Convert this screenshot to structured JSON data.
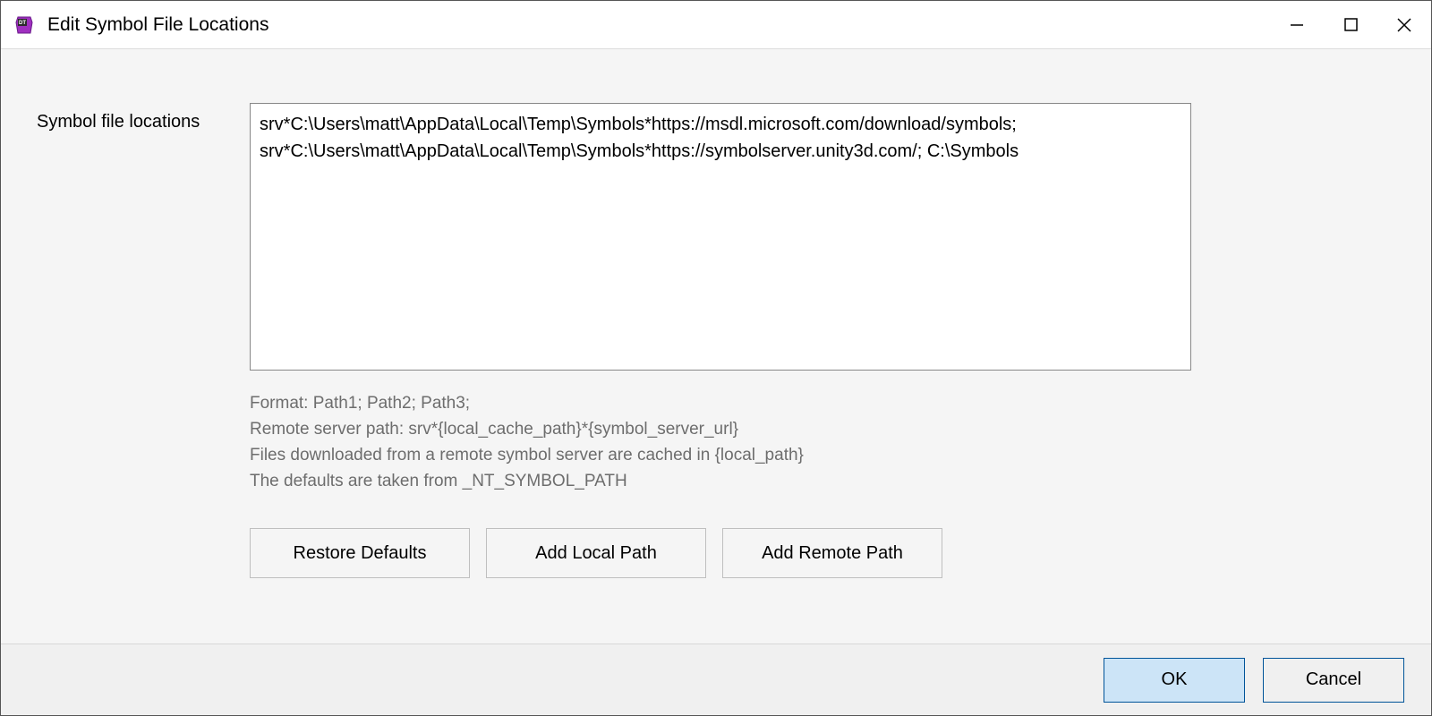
{
  "window": {
    "title": "Edit Symbol File Locations"
  },
  "form": {
    "label": "Symbol file locations",
    "value": "srv*C:\\Users\\matt\\AppData\\Local\\Temp\\Symbols*https://msdl.microsoft.com/download/symbols; srv*C:\\Users\\matt\\AppData\\Local\\Temp\\Symbols*https://symbolserver.unity3d.com/; C:\\Symbols"
  },
  "help": {
    "line1": "Format: Path1; Path2; Path3;",
    "line2": "Remote server path: srv*{local_cache_path}*{symbol_server_url}",
    "line3": "Files downloaded from a remote symbol server are cached in {local_path}",
    "line4": "The defaults are taken from _NT_SYMBOL_PATH"
  },
  "buttons": {
    "restore_defaults": "Restore Defaults",
    "add_local_path": "Add Local Path",
    "add_remote_path": "Add Remote Path",
    "ok": "OK",
    "cancel": "Cancel"
  }
}
